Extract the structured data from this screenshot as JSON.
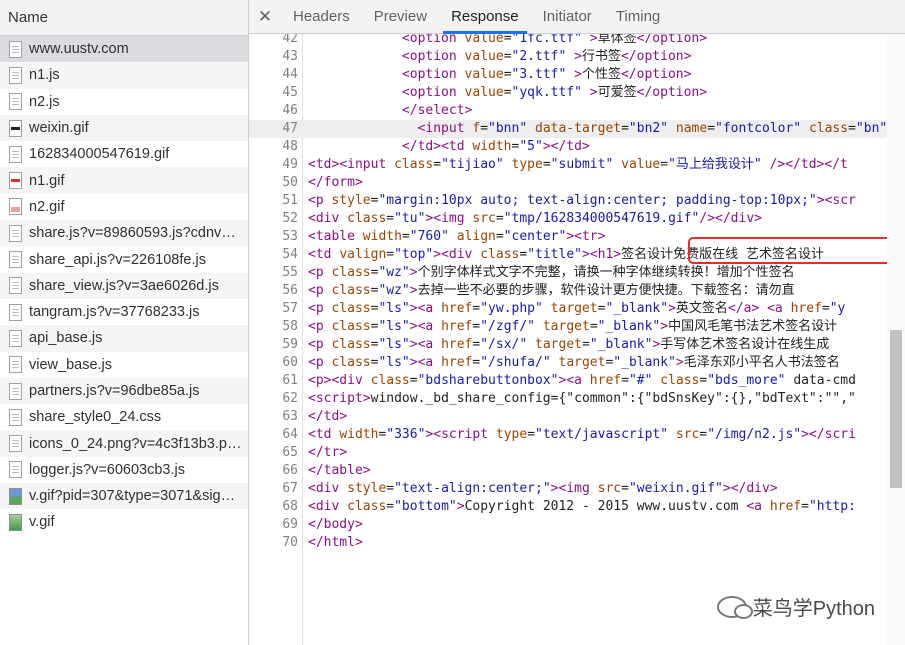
{
  "requests": {
    "header": "Name",
    "items": [
      {
        "name": "www.uustv.com",
        "icon": "document-icon",
        "selected": true
      },
      {
        "name": "n1.js",
        "icon": "script-file-icon"
      },
      {
        "name": "n2.js",
        "icon": "script-file-icon"
      },
      {
        "name": "weixin.gif",
        "icon": "image-file-icon"
      },
      {
        "name": "162834000547619.gif",
        "icon": "document-icon"
      },
      {
        "name": "n1.gif",
        "icon": "image-file-icon"
      },
      {
        "name": "n2.gif",
        "icon": "image-file-icon"
      },
      {
        "name": "share.js?v=89860593.js?cdnversion=...",
        "icon": "script-file-icon"
      },
      {
        "name": "share_api.js?v=226108fe.js",
        "icon": "script-file-icon"
      },
      {
        "name": "share_view.js?v=3ae6026d.js",
        "icon": "script-file-icon"
      },
      {
        "name": "tangram.js?v=37768233.js",
        "icon": "script-file-icon"
      },
      {
        "name": "api_base.js",
        "icon": "script-file-icon"
      },
      {
        "name": "view_base.js",
        "icon": "script-file-icon"
      },
      {
        "name": "partners.js?v=96dbe85a.js",
        "icon": "script-file-icon"
      },
      {
        "name": "share_style0_24.css",
        "icon": "script-file-icon"
      },
      {
        "name": "icons_0_24.png?v=4c3f13b3.png",
        "icon": "image-file-icon"
      },
      {
        "name": "logger.js?v=60603cb3.js",
        "icon": "script-file-icon"
      },
      {
        "name": "v.gif?pid=307&type=3071&sign=...",
        "icon": "image-file-icon"
      },
      {
        "name": "v.gif",
        "icon": "image-file-icon"
      }
    ]
  },
  "tabs": {
    "close": "✕",
    "items": [
      "Headers",
      "Preview",
      "Response",
      "Initiator",
      "Timing"
    ],
    "active": "Response"
  },
  "code": {
    "lines": [
      {
        "n": 42,
        "t": "            <option value=\"1fc.ttf\" >草体签</option>"
      },
      {
        "n": 43,
        "t": "            <option value=\"2.ttf\" >行书签</option>"
      },
      {
        "n": 44,
        "t": "            <option value=\"3.ttf\" >个性签</option>"
      },
      {
        "n": 45,
        "t": "            <option value=\"yqk.ttf\" >可爱签</option>"
      },
      {
        "n": 46,
        "t": "            </select>"
      },
      {
        "n": 47,
        "t": "              <input f=\"bnn\" data-target=\"bn2\" name=\"fontcolor\" class=\"bn\" "
      },
      {
        "n": 48,
        "t": "            </td><td width=\"5\"></td>"
      },
      {
        "n": 49,
        "t": "<td><input class=\"tijiao\" type=\"submit\" value=\"马上给我设计\" /></td></t"
      },
      {
        "n": 50,
        "t": "</form>"
      },
      {
        "n": 51,
        "t": "<p style=\"margin:10px auto; text-align:center; padding-top:10px;\"><scr"
      },
      {
        "n": 52,
        "t": "<div class=\"tu\"><img src=\"tmp/162834000547619.gif\"/></div>"
      },
      {
        "n": 53,
        "t": "<table width=\"760\" align=\"center\"><tr>"
      },
      {
        "n": 54,
        "t": "<td valign=\"top\"><div class=\"title\"><h1>签名设计免费版在线 艺术签名设计"
      },
      {
        "n": 55,
        "t": "<p class=\"wz\">个别字体样式文字不完整，请换一种字体继续转换！增加个性签名"
      },
      {
        "n": 56,
        "t": "<p class=\"wz\">去掉一些不必要的步骤，软件设计更方便快捷。下载签名：请勿直"
      },
      {
        "n": 57,
        "t": "<p class=\"ls\"><a href=\"yw.php\" target=\"_blank\">英文签名</a> <a href=\"y"
      },
      {
        "n": 58,
        "t": "<p class=\"ls\"><a href=\"/zgf/\" target=\"_blank\">中国风毛笔书法艺术签名设计"
      },
      {
        "n": 59,
        "t": "<p class=\"ls\"><a href=\"/sx/\" target=\"_blank\">手写体艺术签名设计在线生成"
      },
      {
        "n": 60,
        "t": "<p class=\"ls\"><a href=\"/shufa/\" target=\"_blank\">毛泽东邓小平名人书法签名"
      },
      {
        "n": 61,
        "t": "<p><div class=\"bdsharebuttonbox\"><a href=\"#\" class=\"bds_more\" data-cmd"
      },
      {
        "n": 62,
        "t": "<script>window._bd_share_config={\"common\":{\"bdSnsKey\":{},\"bdText\":\"\",\""
      },
      {
        "n": 63,
        "t": "</td>"
      },
      {
        "n": 64,
        "t": "<td width=\"336\"><script type=\"text/javascript\" src=\"/img/n2.js\"></scri"
      },
      {
        "n": 65,
        "t": "</tr>"
      },
      {
        "n": 66,
        "t": "</table>"
      },
      {
        "n": 67,
        "t": "<div style=\"text-align:center;\"><img src=\"weixin.gif\"></div>"
      },
      {
        "n": 68,
        "t": "<div class=\"bottom\">Copyright 2012 - 2015 www.uustv.com <a href=\"http:"
      },
      {
        "n": 69,
        "t": "</body>"
      },
      {
        "n": 70,
        "t": "</html>"
      }
    ],
    "highlighted_line": 47,
    "annotated_line": 52
  },
  "watermark": {
    "text": "菜鸟学Python",
    "icon": "wechat-icon"
  },
  "colors": {
    "annotation": "#e52d2d",
    "active_tab_underline": "#1a73e8"
  }
}
